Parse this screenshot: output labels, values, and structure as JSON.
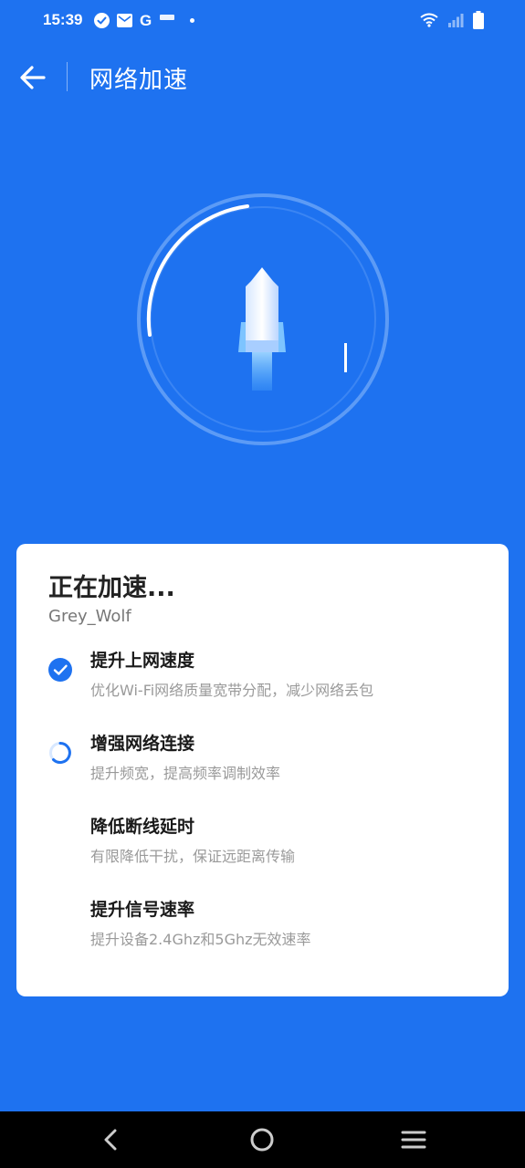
{
  "status_bar": {
    "time": "15:39",
    "left_icons": [
      "check-circle-icon",
      "mail-icon",
      "google-icon",
      "notification-icon",
      "dot-icon"
    ],
    "google_glyph": "G",
    "right_icons": [
      "wifi-icon",
      "signal-icon",
      "battery-icon"
    ]
  },
  "header": {
    "title": "网络加速",
    "back_icon": "back-arrow-icon"
  },
  "gauge": {
    "center_icon": "rocket-icon",
    "progress_arc": "partial"
  },
  "card": {
    "title": "正在加速...",
    "network_name": "Grey_Wolf",
    "tasks": [
      {
        "title": "提升上网速度",
        "description": "优化Wi-Fi网络质量宽带分配，减少网络丢包",
        "status": "done"
      },
      {
        "title": "增强网络连接",
        "description": "提升频宽，提高频率调制效率",
        "status": "in-progress"
      },
      {
        "title": "降低断线延时",
        "description": "有限降低干扰，保证远距离传输",
        "status": "pending"
      },
      {
        "title": "提升信号速率",
        "description": "提升设备2.4Ghz和5Ghz无效速率",
        "status": "pending"
      }
    ]
  },
  "colors": {
    "background": "#1E72F0",
    "card": "#FFFFFF",
    "done": "#1E72F0"
  },
  "nav_bar": {
    "icons": [
      "nav-back-icon",
      "nav-home-icon",
      "nav-menu-icon"
    ]
  }
}
